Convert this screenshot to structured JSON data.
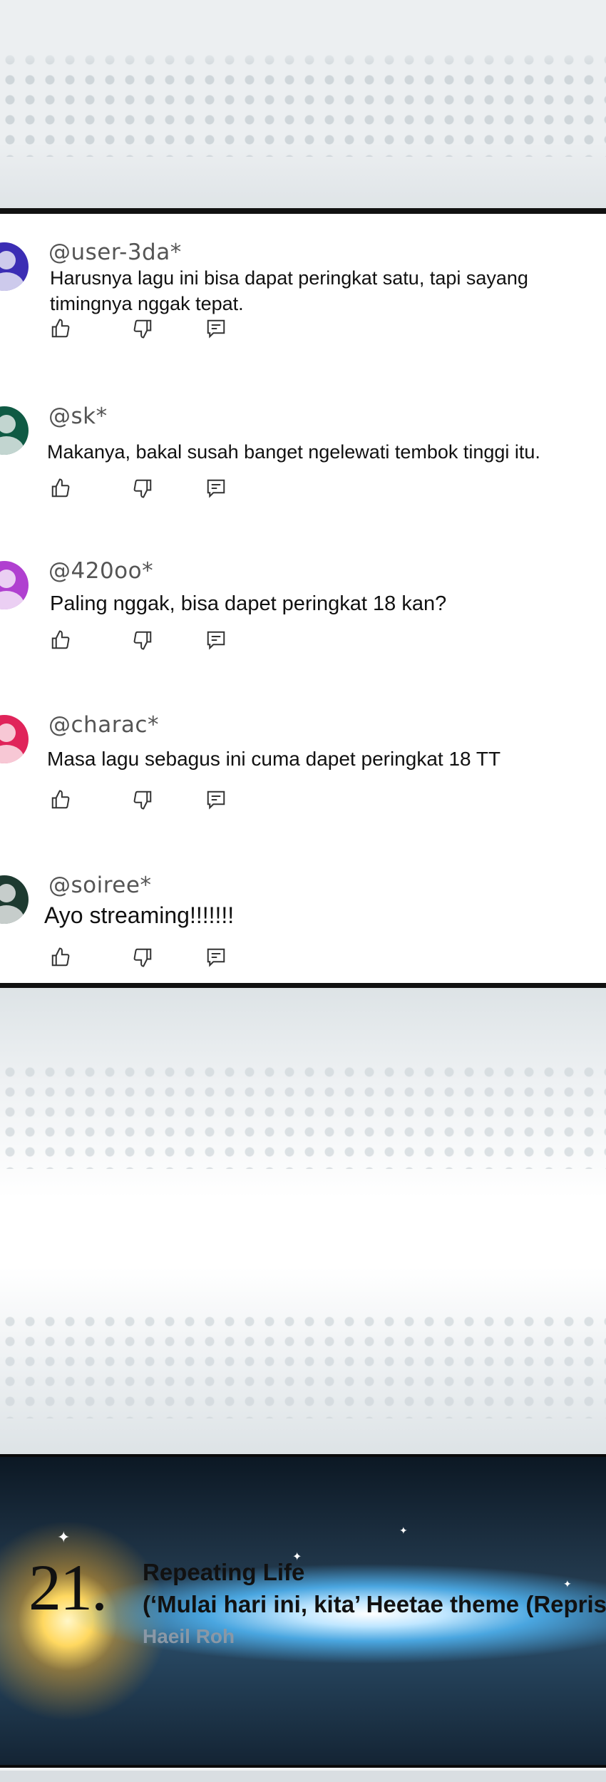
{
  "comments": [
    {
      "handle": "@user-3da*",
      "text": "Harusnya lagu ini bisa dapat peringkat satu, tapi sayang timingnya nggak tepat.",
      "avatar_color": "#3b2db4"
    },
    {
      "handle": "@sk*",
      "text": "Makanya, bakal susah banget ngelewati tembok tinggi itu.",
      "avatar_color": "#0f5a44"
    },
    {
      "handle": "@420oo*",
      "text": "Paling nggak, bisa dapet peringkat 18 kan?",
      "avatar_color": "#b040d0"
    },
    {
      "handle": "@charac*",
      "text": "Masa lagu sebagus ini cuma dapet peringkat 18 TT",
      "avatar_color": "#e0245a"
    },
    {
      "handle": "@soiree*",
      "text": "Ayo streaming!!!!!!!",
      "avatar_color": "#1d3a30"
    }
  ],
  "actions": {
    "like_icon": "thumbs-up-icon",
    "dislike_icon": "thumbs-down-icon",
    "reply_icon": "reply-icon"
  },
  "track": {
    "number": "21.",
    "title": "Repeating Life",
    "subtitle": "(‘Mulai hari ini, kita’ Heetae theme (Reprise))",
    "artist": "Haeil Roh"
  }
}
